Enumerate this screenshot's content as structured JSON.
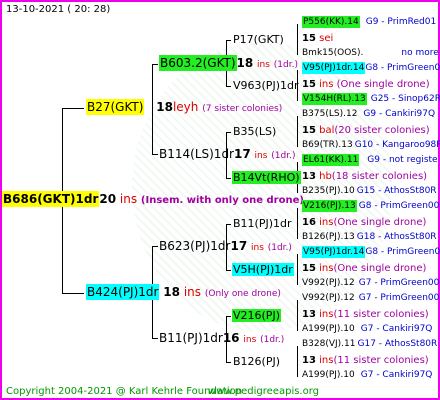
{
  "header": {
    "date": "13-10-2021 ( 20: 28)"
  },
  "footer": {
    "copyright": "Copyright 2004-2021 @ Karl Kehrle Foundation",
    "site": "www.pedigreeapis.org"
  },
  "colors": {
    "border": "#ee00ee",
    "yellow": "#ffff00",
    "green": "#22ee22",
    "cyan": "#00ffff",
    "red": "#dd0000",
    "purple": "#a000a0",
    "blue": "#0000cc",
    "footer": "#009900"
  },
  "gen0": {
    "name": "B686(GKT)1dr",
    "count": "20",
    "unit": "ins",
    "note": "(Insem. with only one drone)"
  },
  "gen1": [
    {
      "name": "B27(GKT)",
      "count": "18",
      "unit": "leyh",
      "note": "(7 sister colonies)"
    },
    {
      "name": "B424(PJ)1dr",
      "count": "18",
      "unit": "ins",
      "note": "(Only one drone)"
    }
  ],
  "gen2": [
    {
      "name": "B603.2(GKT)",
      "count": "18",
      "unit": "ins",
      "note": "(1dr.)"
    },
    {
      "name": "B114(LS)1dr",
      "count": "17",
      "unit": "ins",
      "note": "(1dr.)"
    },
    {
      "name": "B623(PJ)1dr",
      "count": "17",
      "unit": "ins",
      "note": "(1dr.)"
    },
    {
      "name": "B11(PJ)1dr",
      "count": "16",
      "unit": "ins",
      "note": "(1dr.)"
    }
  ],
  "gen3": [
    {
      "name": "P17(GKT)",
      "count": "15",
      "unit": "sei",
      "note": ""
    },
    {
      "name": "V963(PJ)1dr",
      "count": "15",
      "unit": "ins",
      "note": "(One single drone)"
    },
    {
      "name": "B35(LS)",
      "count": "15",
      "unit": "bal",
      "note": "(20 sister colonies)"
    },
    {
      "name": "B14Vt(RHO)",
      "count": "13",
      "unit": "hb",
      "note": "(18 sister colonies)"
    },
    {
      "name": "B11(PJ)1dr",
      "count": "16",
      "unit": "ins",
      "note": "(One single drone)"
    },
    {
      "name": "V5H(PJ)1dr",
      "count": "15",
      "unit": "ins",
      "note": "(One single drone)"
    },
    {
      "name": "V216(PJ)",
      "count": "13",
      "unit": "ins",
      "note": "(11 sister colonies)"
    },
    {
      "name": "B126(PJ)",
      "count": "13",
      "unit": "ins",
      "note": "(11 sister colonies)"
    }
  ],
  "gen4": [
    {
      "name": "P556(KK).14",
      "tag": "G9 - PrimRed01"
    },
    {
      "name": "Bmk15(OOS).",
      "tag": "no more"
    },
    {
      "name": "V95(PJ)1dr.14",
      "tag": "G8 - PrimGreen00"
    },
    {
      "name": "V154H(RL).13",
      "tag": "G25 - Sinop62R"
    },
    {
      "name": "B375(LS).12",
      "tag": "G9 - Cankiri97Q"
    },
    {
      "name": "B69(TR).13",
      "tag": "G10 - Kangaroo98R"
    },
    {
      "name": "EL61(KK).11",
      "tag": "G9 - not registe"
    },
    {
      "name": "B235(PJ).10",
      "tag": "G15 - AthosSt80R"
    },
    {
      "name": "V216(PJ).13",
      "tag": "G8 - PrimGreen00"
    },
    {
      "name": "B126(PJ).13",
      "tag": "G18 - AthosSt80R"
    },
    {
      "name": "V95(PJ)1dr.14",
      "tag": "G8 - PrimGreen00"
    },
    {
      "name": "V992(PJ).12",
      "tag": "G7 - PrimGreen00"
    },
    {
      "name": "V992(PJ).12",
      "tag": "G7 - PrimGreen00"
    },
    {
      "name": "A199(PJ).10",
      "tag": "G7 - Cankiri97Q"
    },
    {
      "name": "B328(VJ).11",
      "tag": "G17 - AthosSt80R"
    },
    {
      "name": "A199(PJ).10",
      "tag": "G7 - Cankiri97Q"
    }
  ]
}
